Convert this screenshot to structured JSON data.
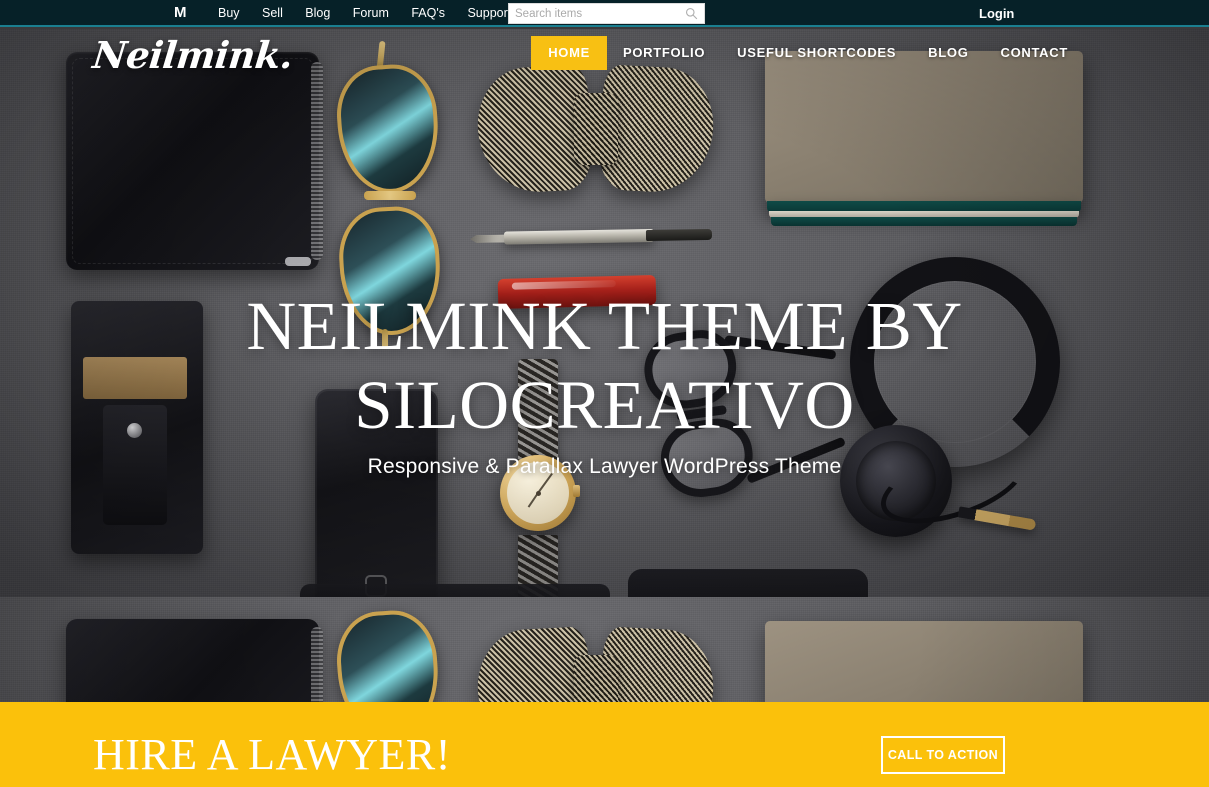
{
  "topbar": {
    "brand_mark": "M",
    "brand_mark_icon": "m-logo-icon",
    "links": [
      {
        "label": "Buy"
      },
      {
        "label": "Sell"
      },
      {
        "label": "Blog"
      },
      {
        "label": "Forum"
      },
      {
        "label": "FAQ's"
      },
      {
        "label": "Support"
      }
    ],
    "search": {
      "placeholder": "Search items",
      "value": "",
      "icon": "search-icon"
    },
    "login_label": "Login",
    "background_color": "#062128",
    "accent_line_color": "#1a7f90"
  },
  "header": {
    "logo_text": "Neilmink.",
    "nav": [
      {
        "label": "HOME",
        "active": true
      },
      {
        "label": "PORTFOLIO",
        "active": false
      },
      {
        "label": "USEFUL SHORTCODES",
        "active": false
      },
      {
        "label": "BLOG",
        "active": false
      },
      {
        "label": "CONTACT",
        "active": false
      }
    ],
    "active_bg_color": "#f8c013"
  },
  "hero": {
    "title": "NEILMINK THEME BY SILOCREATIVO",
    "subtitle": "Responsive & Parallax Lawyer WordPress Theme",
    "background_description": "flat-lay photograph of mens accessories on grey felt"
  },
  "cta": {
    "title": "HIRE A LAWYER!",
    "button_label": "CALL TO ACTION",
    "background_color": "#fbc10b",
    "text_color": "#ffffff"
  }
}
